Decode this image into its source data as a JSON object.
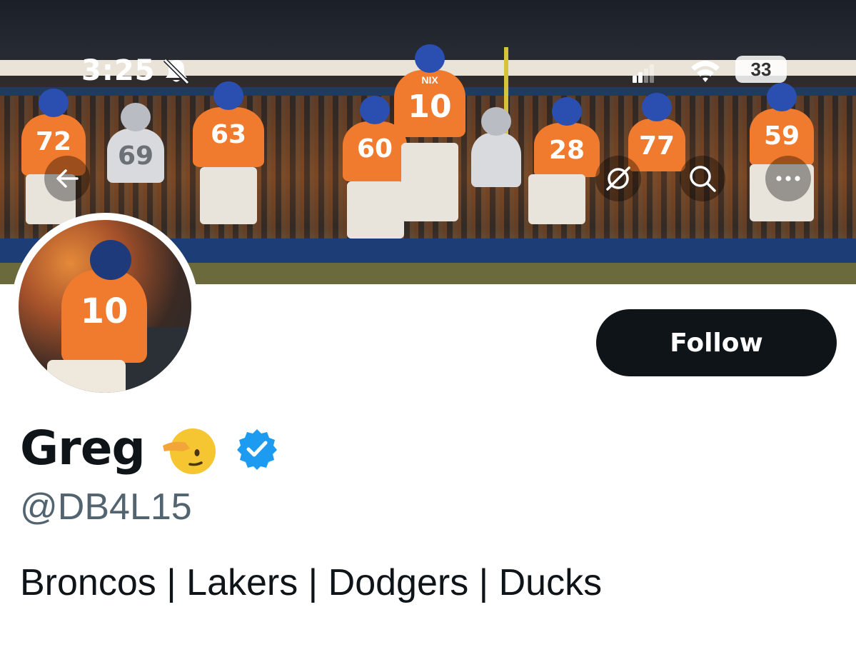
{
  "status_bar": {
    "time": "3:25",
    "battery": "33",
    "icons": [
      "bell-slash-icon",
      "signal-icon",
      "wifi-icon",
      "battery-icon"
    ]
  },
  "header": {
    "back_icon": "arrow-left-icon",
    "actions": [
      "hide-icon",
      "search-icon",
      "more-icon"
    ]
  },
  "banner": {
    "jersey_numbers": [
      "72",
      "69",
      "63",
      "60",
      "10",
      "28",
      "77",
      "59"
    ],
    "name_bar": "NIX"
  },
  "profile": {
    "display_name": "Greg",
    "emoji": "saluting-face",
    "verified": true,
    "handle": "@DB4L15",
    "bio": "Broncos | Lakers | Dodgers | Ducks",
    "avatar_number": "10"
  },
  "actions": {
    "follow_label": "Follow"
  },
  "colors": {
    "follow_bg": "#0f1419",
    "verified": "#1d9bf0",
    "handle": "#536471"
  }
}
